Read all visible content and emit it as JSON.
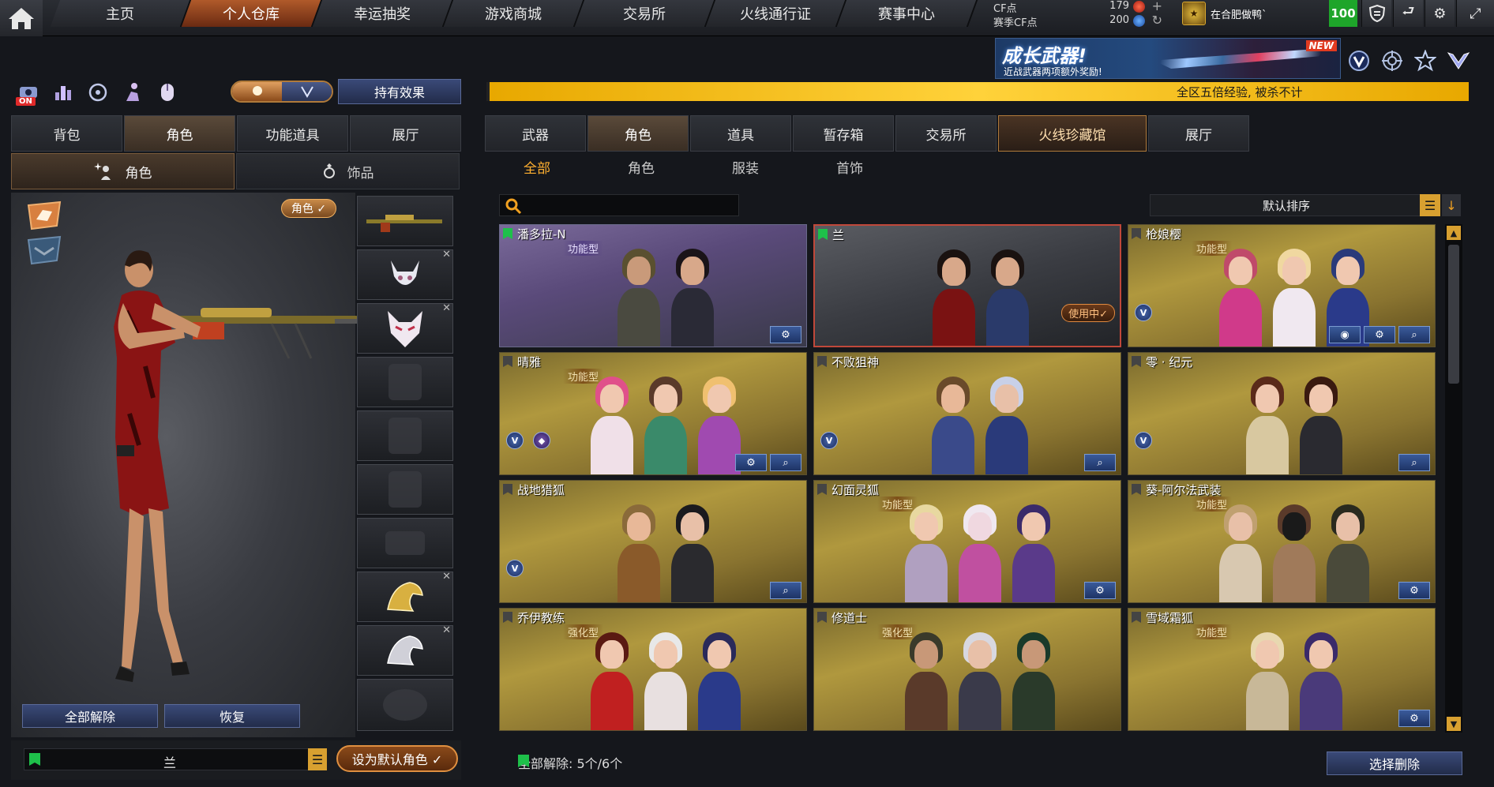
{
  "nav": {
    "tabs": [
      {
        "label": "主页"
      },
      {
        "label": "个人仓库"
      },
      {
        "label": "幸运抽奖"
      },
      {
        "label": "游戏商城"
      },
      {
        "label": "交易所"
      },
      {
        "label": "火线通行证"
      },
      {
        "label": "赛事中心"
      }
    ],
    "active_tab": "个人仓库",
    "cf_points_label": "CF点",
    "cf_points_value": "179",
    "season_points_label": "赛季CF点",
    "season_points_value": "200",
    "clan_name": "在合肥做鸭`",
    "level": "100"
  },
  "banner": {
    "title": "成长武器!",
    "subtitle": "近战武器两项额外奖励!",
    "badge": "NEW"
  },
  "marquee": {
    "text": "全区五倍经验, 被杀不计"
  },
  "left": {
    "on_badge": "ON",
    "effect_button": "持有效果",
    "tabs": [
      {
        "label": "背包"
      },
      {
        "label": "角色"
      },
      {
        "label": "功能道具"
      },
      {
        "label": "展厅"
      }
    ],
    "active_tab": "角色",
    "subtabs": [
      {
        "label": "角色"
      },
      {
        "label": "饰品"
      }
    ],
    "role_pill": "角色 ✓",
    "unequip_all": "全部解除",
    "restore": "恢复",
    "character_name": "兰",
    "set_default": "设为默认角色 ✓"
  },
  "right": {
    "tabs": [
      {
        "label": "武器"
      },
      {
        "label": "角色"
      },
      {
        "label": "道具"
      },
      {
        "label": "暂存箱"
      },
      {
        "label": "交易所"
      },
      {
        "label": "火线珍藏馆"
      },
      {
        "label": "展厅"
      }
    ],
    "active_tab": "角色",
    "categories": [
      {
        "label": "全部"
      },
      {
        "label": "角色"
      },
      {
        "label": "服装"
      },
      {
        "label": "首饰"
      }
    ],
    "active_category": "全部",
    "search_placeholder": "",
    "sort_label": "默认排序",
    "cards": [
      {
        "name": "潘多拉-N",
        "type": "功能型",
        "style": "purple",
        "fav": true
      },
      {
        "name": "兰",
        "type": "",
        "style": "dark",
        "fav": true,
        "status": "使用中✓"
      },
      {
        "name": "枪娘樱",
        "type": "功能型",
        "style": "gold",
        "fav": false
      },
      {
        "name": "晴雅",
        "type": "功能型",
        "style": "gold",
        "fav": false
      },
      {
        "name": "不败狙神",
        "type": "",
        "style": "gold",
        "fav": false
      },
      {
        "name": "零 · 纪元",
        "type": "",
        "style": "gold",
        "fav": false
      },
      {
        "name": "战地猎狐",
        "type": "",
        "style": "gold",
        "fav": false
      },
      {
        "name": "幻面灵狐",
        "type": "功能型",
        "style": "gold",
        "fav": false
      },
      {
        "name": "葵-阿尔法武装",
        "type": "功能型",
        "style": "gold",
        "fav": false
      },
      {
        "name": "乔伊教练",
        "type": "强化型",
        "style": "gold",
        "fav": false
      },
      {
        "name": "修道士",
        "type": "强化型",
        "style": "gold",
        "fav": false
      },
      {
        "name": "雪域霜狐",
        "type": "功能型",
        "style": "gold",
        "fav": false
      }
    ],
    "unequip_info": "全部解除:  5个/6个",
    "select_delete": "选择删除"
  },
  "colors": {
    "accent": "#ffb030",
    "gold_card": "#b0983e",
    "fav_green": "#1ec04a",
    "level_green": "#1ea52a"
  }
}
